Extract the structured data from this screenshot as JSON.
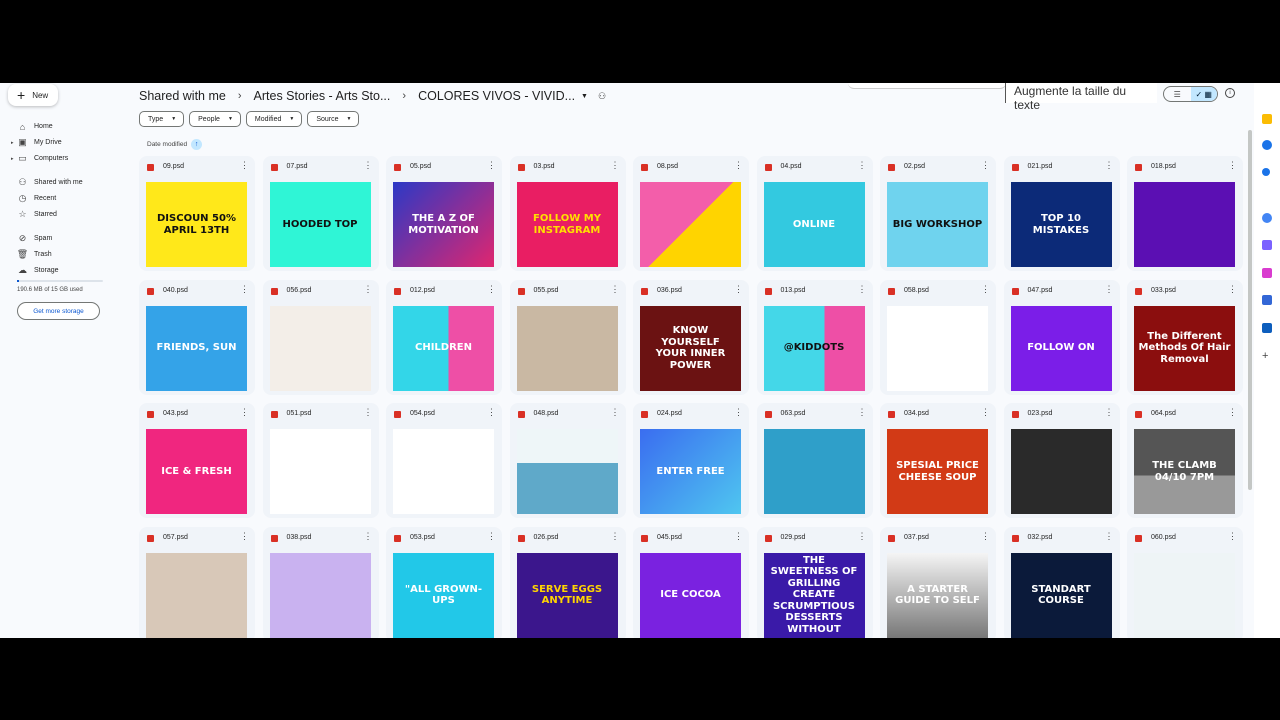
{
  "sidebar": {
    "new_label": "New",
    "items": [
      {
        "label": "Home",
        "icon": "home-icon",
        "glyph": "⌂"
      },
      {
        "label": "My Drive",
        "icon": "drive-icon",
        "glyph": "▣"
      },
      {
        "label": "Computers",
        "icon": "computer-icon",
        "glyph": "▭"
      },
      {
        "label": "Shared with me",
        "icon": "people-icon",
        "glyph": "⚇"
      },
      {
        "label": "Recent",
        "icon": "clock-icon",
        "glyph": "◷"
      },
      {
        "label": "Starred",
        "icon": "star-icon",
        "glyph": "☆"
      },
      {
        "label": "Spam",
        "icon": "spam-icon",
        "glyph": "⊘"
      },
      {
        "label": "Trash",
        "icon": "trash-icon",
        "glyph": "🗑"
      },
      {
        "label": "Storage",
        "icon": "cloud-icon",
        "glyph": "☁"
      }
    ],
    "storage_text": "190.6 MB of 15 GB used",
    "storage_fraction": 0.012,
    "get_storage_label": "Get more storage"
  },
  "breadcrumb": [
    "Shared with me",
    "Artes Stories - Arts Sto...",
    "COLORES VIVOS - VIVID..."
  ],
  "tooltip": "Augmente la taille du texte",
  "filters": [
    "Type",
    "People",
    "Modified",
    "Source"
  ],
  "sort_label": "Date modified",
  "accent": "#0b57d0",
  "files": [
    {
      "name": "09.psd",
      "bg": "#ffe81a",
      "fg": "#111",
      "text": "DISCOUN 50% APRIL 13TH"
    },
    {
      "name": "07.psd",
      "bg": "#2ff5d6",
      "fg": "#111",
      "text": "HOODED TOP"
    },
    {
      "name": "05.psd",
      "bg": "linear-gradient(135deg,#2b39c6,#e0266f)",
      "fg": "#fff",
      "text": "THE A Z OF MOTIVATION"
    },
    {
      "name": "03.psd",
      "bg": "#e91e63",
      "fg": "#ffe000",
      "text": "FOLLOW MY INSTAGRAM"
    },
    {
      "name": "08.psd",
      "bg": "linear-gradient(135deg,#f35eaa 50%,#ffd400 50%)",
      "fg": "#fff",
      "text": ""
    },
    {
      "name": "04.psd",
      "bg": "#33c9e0",
      "fg": "#fff",
      "text": "ONLINE"
    },
    {
      "name": "02.psd",
      "bg": "#6fd3ee",
      "fg": "#111",
      "text": "BIG WORKSHOP"
    },
    {
      "name": "021.psd",
      "bg": "#0c2a78",
      "fg": "#fff",
      "text": "TOP 10 MISTAKES"
    },
    {
      "name": "018.psd",
      "bg": "#5b0fb3",
      "fg": "#fff",
      "text": ""
    },
    {
      "name": "040.psd",
      "bg": "#34a3e8",
      "fg": "#fff",
      "text": "FRIENDS, SUN"
    },
    {
      "name": "056.psd",
      "bg": "#f3eee8",
      "fg": "#333",
      "text": ""
    },
    {
      "name": "012.psd",
      "bg": "linear-gradient(90deg,#33d6e8 55%,#ee4fa6 55%)",
      "fg": "#fff",
      "text": "CHILDREN"
    },
    {
      "name": "055.psd",
      "bg": "#c9b8a3",
      "fg": "#fff",
      "text": ""
    },
    {
      "name": "036.psd",
      "bg": "#6b1212",
      "fg": "#fff",
      "text": "KNOW YOURSELF YOUR INNER POWER"
    },
    {
      "name": "013.psd",
      "bg": "linear-gradient(90deg,#44d7e8 60%,#ee4fa6 60%)",
      "fg": "#111",
      "text": "@KIDDOTS"
    },
    {
      "name": "058.psd",
      "bg": "#ffffff",
      "fg": "#111",
      "text": ""
    },
    {
      "name": "047.psd",
      "bg": "#7b1ee8",
      "fg": "#fff",
      "text": "FOLLOW ON"
    },
    {
      "name": "033.psd",
      "bg": "#8b0e0e",
      "fg": "#fff",
      "text": "The Different Methods Of Hair Removal"
    },
    {
      "name": "043.psd",
      "bg": "#f0267f",
      "fg": "#fff",
      "text": "ICE & FRESH"
    },
    {
      "name": "051.psd",
      "bg": "#ffffff",
      "fg": "#111",
      "text": ""
    },
    {
      "name": "054.psd",
      "bg": "#ffffff",
      "fg": "#111",
      "text": ""
    },
    {
      "name": "048.psd",
      "bg": "linear-gradient(180deg,#eef6f8 40%,#5fa9c9 40%)",
      "fg": "#111",
      "text": ""
    },
    {
      "name": "024.psd",
      "bg": "linear-gradient(135deg,#3a6df0,#4fc6f0)",
      "fg": "#fff",
      "text": "ENTER FREE"
    },
    {
      "name": "063.psd",
      "bg": "#2f9fc9",
      "fg": "#fff",
      "text": ""
    },
    {
      "name": "034.psd",
      "bg": "#d23a16",
      "fg": "#fff",
      "text": "SPESIAL PRICE CHEESE SOUP"
    },
    {
      "name": "023.psd",
      "bg": "#2a2a2a",
      "fg": "#fff",
      "text": ""
    },
    {
      "name": "064.psd",
      "bg": "linear-gradient(180deg,#555 55%,#999 55%)",
      "fg": "#fff",
      "text": "THE CLAMB 04/10 7PM"
    },
    {
      "name": "057.psd",
      "bg": "#d8c8b8",
      "fg": "#111",
      "text": ""
    },
    {
      "name": "038.psd",
      "bg": "#c9b2f0",
      "fg": "#fff",
      "text": ""
    },
    {
      "name": "053.psd",
      "bg": "#22c8e8",
      "fg": "#fff",
      "text": "\"ALL GROWN-UPS"
    },
    {
      "name": "026.psd",
      "bg": "#3b168c",
      "fg": "#ffd400",
      "text": "SERVE EGGS ANYTIME"
    },
    {
      "name": "045.psd",
      "bg": "#7a22e0",
      "fg": "#fff",
      "text": "ICE COCOA"
    },
    {
      "name": "029.psd",
      "bg": "#3a1aa8",
      "fg": "#fff",
      "text": "THE SWEETNESS OF GRILLING CREATE SCRUMPTIOUS DESSERTS WITHOUT"
    },
    {
      "name": "037.psd",
      "bg": "linear-gradient(180deg,#f5f5f5,#777)",
      "fg": "#fff",
      "text": "A STARTER GUIDE TO SELF"
    },
    {
      "name": "032.psd",
      "bg": "#0b1a3a",
      "fg": "#fff",
      "text": "STANDART COURSE"
    },
    {
      "name": "060.psd",
      "bg": "#eef4f6",
      "fg": "#111",
      "text": ""
    }
  ]
}
